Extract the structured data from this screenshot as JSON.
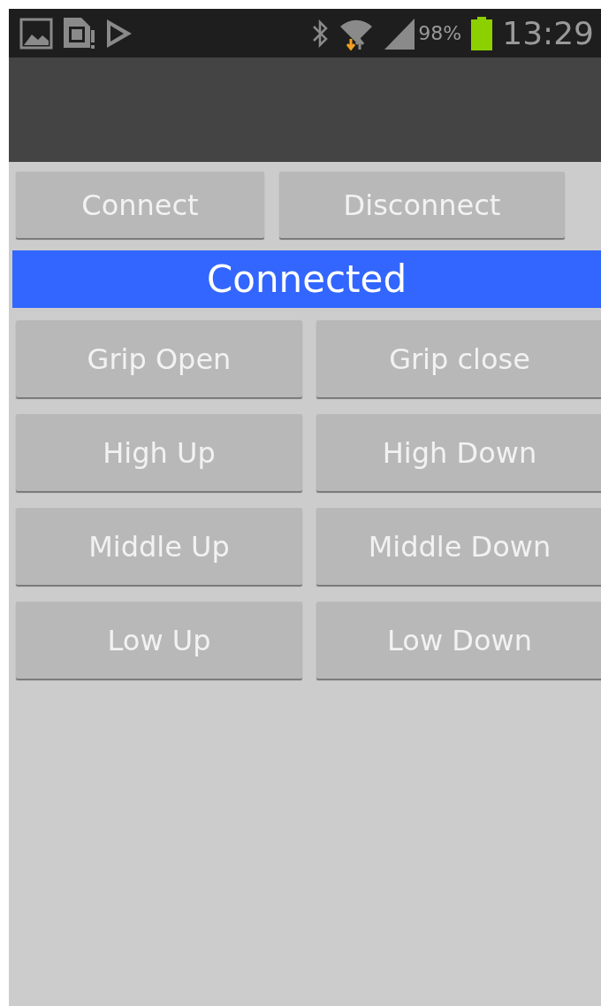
{
  "status_bar": {
    "battery_percent": "98%",
    "time": "13:29"
  },
  "connection_buttons": [
    {
      "label": "Connect"
    },
    {
      "label": "Disconnect"
    }
  ],
  "connection_status": "Connected",
  "control_buttons": [
    {
      "label": "Grip Open"
    },
    {
      "label": "Grip close"
    },
    {
      "label": "High Up"
    },
    {
      "label": "High Down"
    },
    {
      "label": "Middle Up"
    },
    {
      "label": "Middle Down"
    },
    {
      "label": "Low Up"
    },
    {
      "label": "Low Down"
    }
  ]
}
